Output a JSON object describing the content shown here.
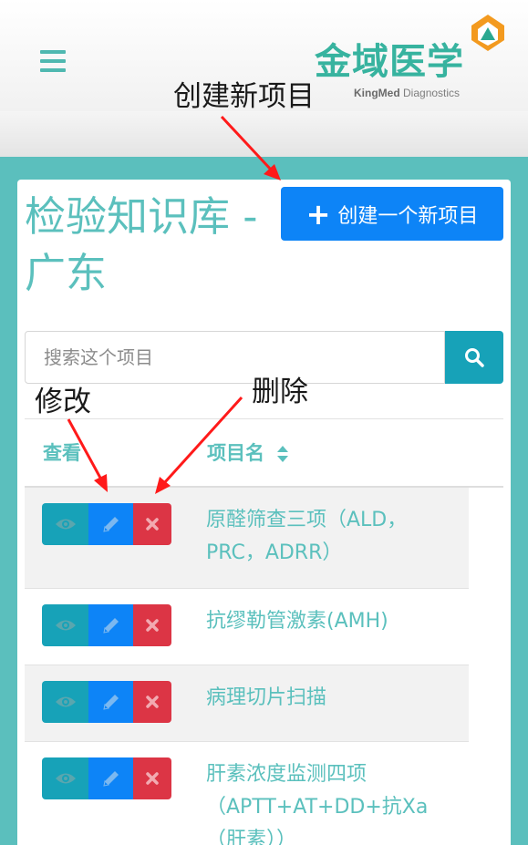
{
  "header": {
    "logo_cn": "金域医学",
    "logo_en_brand": "KingMed",
    "logo_en_rest": "Diagnostics"
  },
  "page": {
    "title": "检验知识库 - 广东",
    "create_button_label": "创建一个新项目",
    "search_placeholder": "搜索这个项目"
  },
  "table": {
    "col_view": "查看",
    "col_name": "项目名",
    "rows": [
      {
        "name": "原醛筛查三项（ALD，PRC，ADRR）"
      },
      {
        "name": "抗缪勒管激素(AMH)"
      },
      {
        "name": "病理切片扫描"
      },
      {
        "name": "肝素浓度监测四项（APTT+AT+DD+抗Xa（肝素））"
      }
    ]
  },
  "annotations": {
    "create": "创建新项目",
    "edit": "修改",
    "delete": "删除"
  },
  "colors": {
    "teal": "#5bc0bd",
    "primary": "#0d84f7",
    "info": "#17a2b8",
    "danger": "#dc3545",
    "arrow": "#ff1a1a"
  },
  "icons": {
    "menu": "hamburger-icon",
    "plus": "plus-icon",
    "search": "search-icon",
    "view": "eye-icon",
    "edit": "pencil-icon",
    "delete": "close-icon",
    "sort": "sort-icon"
  }
}
